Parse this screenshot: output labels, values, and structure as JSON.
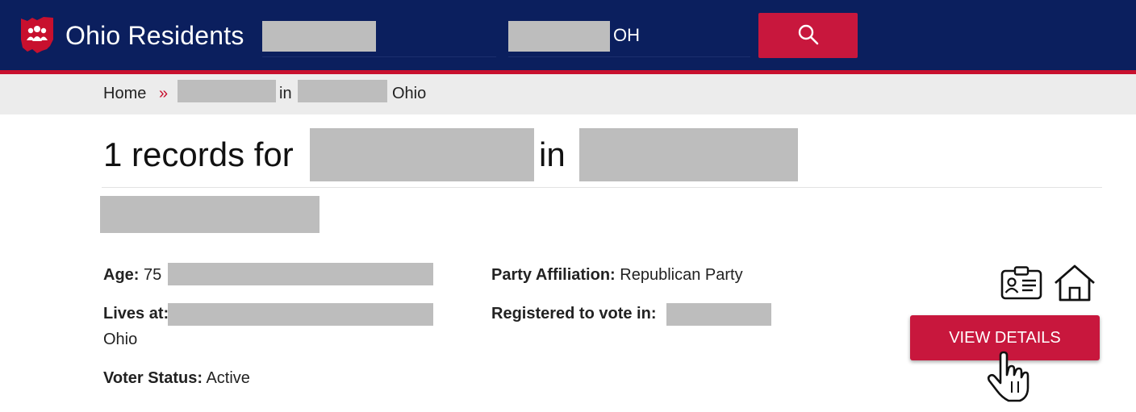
{
  "header": {
    "brand": "Ohio Residents",
    "state_value": "OH"
  },
  "breadcrumb": {
    "home": "Home",
    "separator": "»",
    "in_word": "in",
    "state": "Ohio"
  },
  "results": {
    "title_prefix": "1 records for",
    "title_in": "in"
  },
  "record": {
    "age_label": "Age:",
    "age_value": "75",
    "lives_label": "Lives at:",
    "lives_state": "Ohio",
    "status_label": "Voter Status:",
    "status_value": "Active",
    "party_label": "Party Affiliation:",
    "party_value": "Republican Party",
    "registered_label": "Registered to vote in:",
    "view_details_label": "VIEW DETAILS"
  },
  "colors": {
    "header_bg": "#0b1f5e",
    "accent": "#c8173d",
    "redaction": "#bdbdbd"
  },
  "icons": {
    "logo": "ohio-people-logo-icon",
    "search": "search-icon",
    "id_card": "id-card-icon",
    "house": "house-icon",
    "cursor": "hand-pointer-icon"
  }
}
